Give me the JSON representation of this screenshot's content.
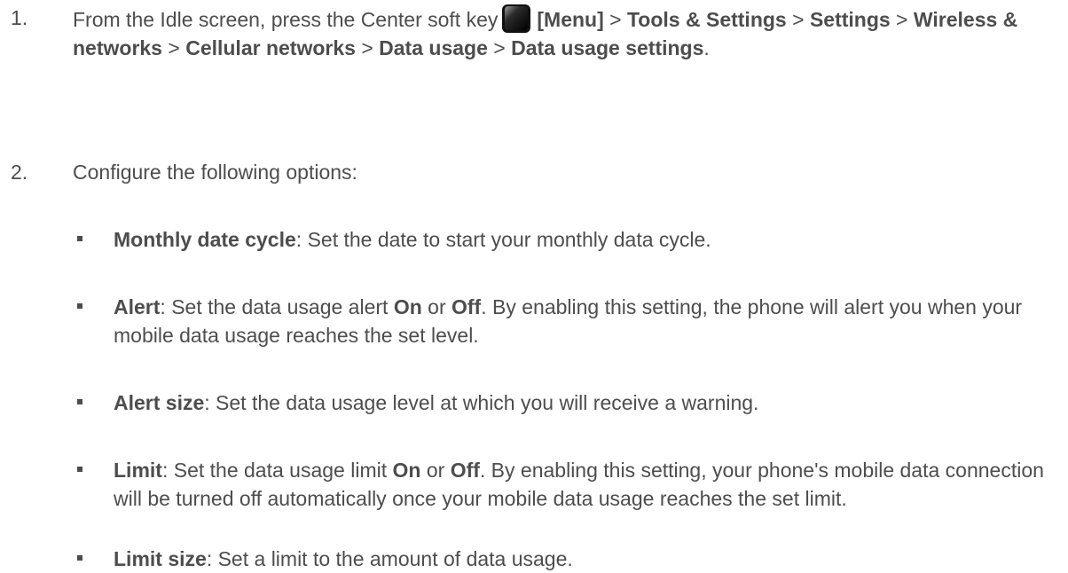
{
  "steps": [
    {
      "number": "1.",
      "pre_icon": "From the Idle screen, press the Center soft key",
      "icon": "center-soft-key-icon",
      "menu": "[Menu]",
      "sep": " > ",
      "path": [
        "Tools & Settings",
        "Settings",
        "Wireless & networks",
        "Cellular networks",
        "Data usage",
        "Data usage settings"
      ],
      "end": "."
    },
    {
      "number": "2.",
      "text": "Configure the following options:"
    }
  ],
  "options": [
    {
      "term": "Monthly date cycle",
      "sep": ":  ",
      "desc": "Set the date to start your monthly data cycle."
    },
    {
      "term": "Alert",
      "sep": ": ",
      "desc_a": "Set the data usage alert ",
      "on": "On",
      "or": " or ",
      "off": "Off",
      "desc_b": ". By enabling this setting, the phone will alert you when your mobile data usage reaches the set level."
    },
    {
      "term": "Alert size",
      "sep": ": ",
      "desc": "Set the data usage level at which you will receive a warning."
    },
    {
      "term": "Limit",
      "sep": ": ",
      "desc_a": "Set the data usage limit ",
      "on": "On",
      "or": " or ",
      "off": "Off",
      "desc_b": ". By enabling this setting, your phone's mobile data connection will be turned off automatically once your mobile data usage reaches the set limit."
    },
    {
      "term": "Limit size",
      "sep": ": ",
      "desc": "Set a limit to the amount of data usage."
    }
  ]
}
